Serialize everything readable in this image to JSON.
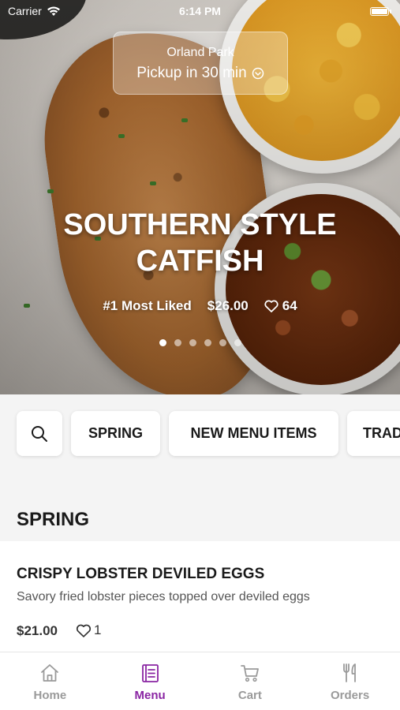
{
  "status_bar": {
    "carrier": "Carrier",
    "time": "6:14 PM"
  },
  "location": {
    "name": "Orland Park",
    "pickup_time": "Pickup in 30 min"
  },
  "hero": {
    "title_line1": "SOUTHERN STYLE",
    "title_line2": "CATFISH",
    "badge": "#1 Most Liked",
    "price": "$26.00",
    "likes": "64",
    "slide_count": 6,
    "active_slide": 1
  },
  "categories": {
    "items": [
      "SPRING",
      "NEW MENU ITEMS",
      "TRAD"
    ]
  },
  "section": {
    "title": "SPRING"
  },
  "menu_item": {
    "name": "CRISPY LOBSTER DEVILED EGGS",
    "description": "Savory fried lobster pieces topped over deviled eggs",
    "price": "$21.00",
    "likes": "1"
  },
  "tabs": [
    {
      "label": "Home",
      "icon": "home-icon",
      "active": false
    },
    {
      "label": "Menu",
      "icon": "menu-icon",
      "active": true
    },
    {
      "label": "Cart",
      "icon": "cart-icon",
      "active": false
    },
    {
      "label": "Orders",
      "icon": "fork-knife-icon",
      "active": false
    }
  ],
  "colors": {
    "accent": "#8a25a3",
    "tab_inactive": "#9a9a9a",
    "background": "#f4f4f4"
  }
}
